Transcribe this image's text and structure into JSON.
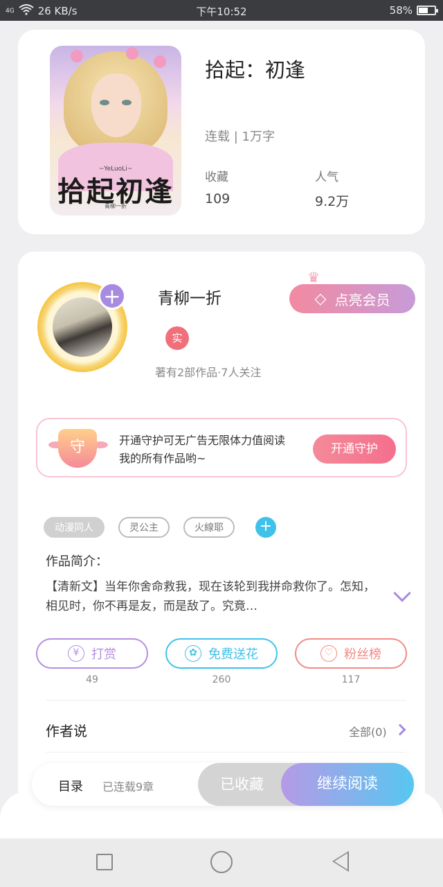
{
  "status_bar": {
    "network": "4G",
    "speed": "26 KB/s",
    "time": "下午10:52",
    "battery": "58%",
    "battery_level": 0.58
  },
  "book": {
    "title": "拾起：初逢",
    "status": "连载 | 1万字",
    "favorites_label": "收藏",
    "favorites_value": "109",
    "popularity_label": "人气",
    "popularity_value": "9.2万",
    "cover": {
      "logo_text": "拾起初逢",
      "logo_sub": "~YeLuoLi~",
      "logo_small": "青柳一折"
    }
  },
  "author": {
    "name": "青柳一折",
    "badge": "实",
    "meta": "著有2部作品·7人关注",
    "vip_button": "点亮会员"
  },
  "guard": {
    "icon_text": "守",
    "text": "开通守护可无广告无限体力值阅读我的所有作品哟~",
    "button": "开通守护"
  },
  "tags": [
    "动漫同人",
    "灵公主",
    "火線耶"
  ],
  "intro": {
    "label": "作品简介：",
    "text": "【清新文】当年你舍命救我，现在该轮到我拼命救你了。怎知，相见时，你不再是友，而是敌了。究竟…"
  },
  "actions": [
    {
      "label": "打赏",
      "count": "49",
      "color": "#b48ee0"
    },
    {
      "label": "免费送花",
      "count": "260",
      "color": "#3fc1ea"
    },
    {
      "label": "粉丝榜",
      "count": "117",
      "color": "#f08a85"
    }
  ],
  "author_says": {
    "title": "作者说",
    "all": "全部(0)"
  },
  "bottom_bar": {
    "toc": "目录",
    "chapters": "已连载9章",
    "favorited": "已收藏",
    "continue": "继续阅读"
  }
}
